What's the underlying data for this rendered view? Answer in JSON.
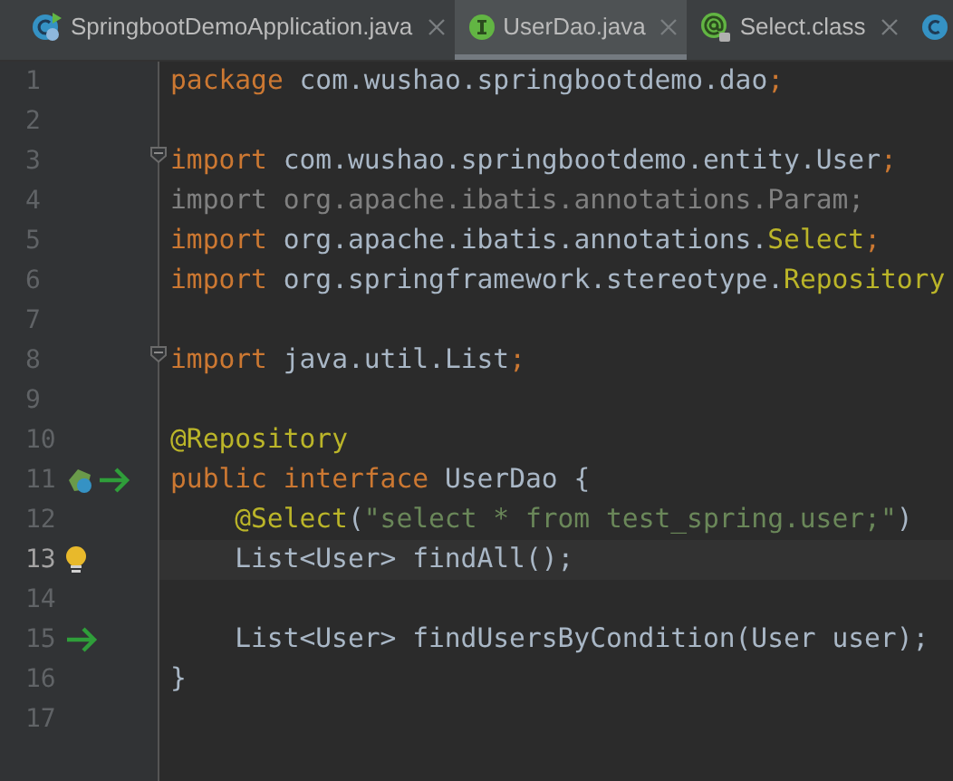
{
  "tabs": [
    {
      "label": "SpringbootDemoApplication.java",
      "kind": "spring-class",
      "selected": false
    },
    {
      "label": "UserDao.java",
      "kind": "interface",
      "selected": true
    },
    {
      "label": "Select.class",
      "kind": "annotation",
      "selected": false
    },
    {
      "kind": "class",
      "selected": false
    }
  ],
  "lines": [
    {
      "number": "1",
      "current": false,
      "fold": false,
      "indent": false,
      "tokens": [
        {
          "text": "package",
          "kind": "keyword"
        },
        {
          "text": " com.wushao.springbootdemo.dao",
          "kind": "plain"
        },
        {
          "text": ";",
          "kind": "keyword"
        }
      ]
    },
    {
      "number": "2",
      "current": false,
      "fold": false
    },
    {
      "number": "3",
      "current": false,
      "fold": true,
      "indent": false,
      "tokens": [
        {
          "text": "import",
          "kind": "keyword"
        },
        {
          "text": " com.wushao.springbootdemo.entity.User",
          "kind": "plain"
        },
        {
          "text": ";",
          "kind": "keyword"
        }
      ]
    },
    {
      "number": "4",
      "current": false,
      "fold": false,
      "indent": false,
      "tokens": [
        {
          "text": "import org.apache.ibatis.annotations.Param;",
          "kind": "unused"
        }
      ]
    },
    {
      "number": "5",
      "current": false,
      "fold": false,
      "indent": false,
      "tokens": [
        {
          "text": "import",
          "kind": "keyword"
        },
        {
          "text": " org.apache.ibatis.annotations.",
          "kind": "plain"
        },
        {
          "text": "Select",
          "kind": "annotation"
        },
        {
          "text": ";",
          "kind": "keyword"
        }
      ]
    },
    {
      "number": "6",
      "current": false,
      "fold": false,
      "indent": false,
      "tokens": [
        {
          "text": "import",
          "kind": "keyword"
        },
        {
          "text": " org.springframework.stereotype.",
          "kind": "plain"
        },
        {
          "text": "Repository",
          "kind": "annotation"
        }
      ]
    },
    {
      "number": "7",
      "current": false,
      "fold": false
    },
    {
      "number": "8",
      "current": false,
      "fold": true,
      "indent": false,
      "tokens": [
        {
          "text": "import",
          "kind": "keyword"
        },
        {
          "text": " java.util.List",
          "kind": "plain"
        },
        {
          "text": ";",
          "kind": "keyword"
        }
      ]
    },
    {
      "number": "9",
      "current": false,
      "fold": false
    },
    {
      "number": "10",
      "current": false,
      "fold": false,
      "indent": false,
      "tokens": [
        {
          "text": "@Repository",
          "kind": "annotation"
        }
      ]
    },
    {
      "number": "11",
      "current": false,
      "fold": false,
      "indent": false,
      "gutter_icons": [
        {
          "kind": "bean"
        },
        {
          "kind": "arrow"
        }
      ],
      "tokens": [
        {
          "text": "public interface",
          "kind": "keyword"
        },
        {
          "text": " UserDao {",
          "kind": "plain"
        }
      ]
    },
    {
      "number": "12",
      "current": false,
      "fold": false,
      "indent": true,
      "tokens": [
        {
          "text": "@Select",
          "kind": "annotation"
        },
        {
          "text": "(",
          "kind": "plain"
        },
        {
          "text": "\"select * from test_spring.user;\"",
          "kind": "string"
        },
        {
          "text": ")",
          "kind": "plain"
        }
      ]
    },
    {
      "number": "13",
      "current": true,
      "fold": false,
      "indent": true,
      "gutter_icons": [
        {
          "kind": "bulb"
        }
      ],
      "tokens": [
        {
          "text": "List<User> findAll();",
          "kind": "plain"
        }
      ]
    },
    {
      "number": "14",
      "current": false,
      "fold": false
    },
    {
      "number": "15",
      "current": false,
      "fold": false,
      "indent": true,
      "gutter_icons": [
        {
          "kind": "arrow"
        }
      ],
      "tokens": [
        {
          "text": "List<User> findUsersByCondition(User user);",
          "kind": "plain"
        }
      ]
    },
    {
      "number": "16",
      "current": false,
      "fold": false,
      "indent": false,
      "tokens": [
        {
          "text": "}",
          "kind": "plain"
        }
      ]
    },
    {
      "number": "17",
      "current": false,
      "fold": false
    }
  ]
}
